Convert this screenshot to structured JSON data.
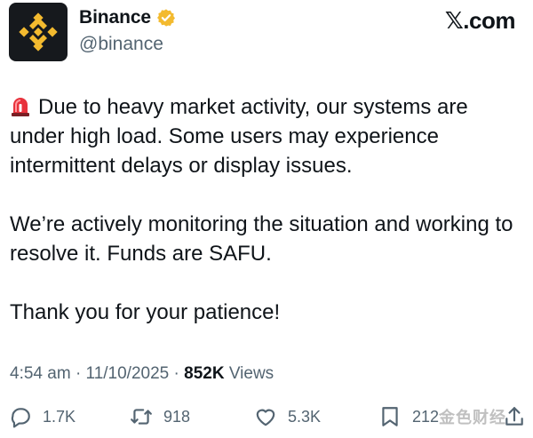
{
  "account": {
    "display_name": "Binance",
    "handle": "@binance",
    "verified_badge_color": "#f3ba2f"
  },
  "brand": {
    "label": "𝕏.com"
  },
  "tweet": {
    "line1": "Due to heavy market activity, our systems are under high load. Some users may experience intermittent delays or display issues.",
    "line2": "We’re actively monitoring the situation and working to resolve it. Funds are SAFU.",
    "line3": "Thank you for your patience!"
  },
  "meta": {
    "time": "4:54 am",
    "separator": "·",
    "date": "11/10/2025",
    "views_count": "852K",
    "views_label": "Views"
  },
  "actions": {
    "replies": "1.7K",
    "reposts": "918",
    "likes": "5.3K",
    "bookmarks": "212"
  },
  "watermark": {
    "text": "金色财经"
  },
  "colors": {
    "text_primary": "#0f1419",
    "text_secondary": "#536471",
    "binance_yellow": "#f3ba2f",
    "avatar_bg": "#16191d"
  }
}
